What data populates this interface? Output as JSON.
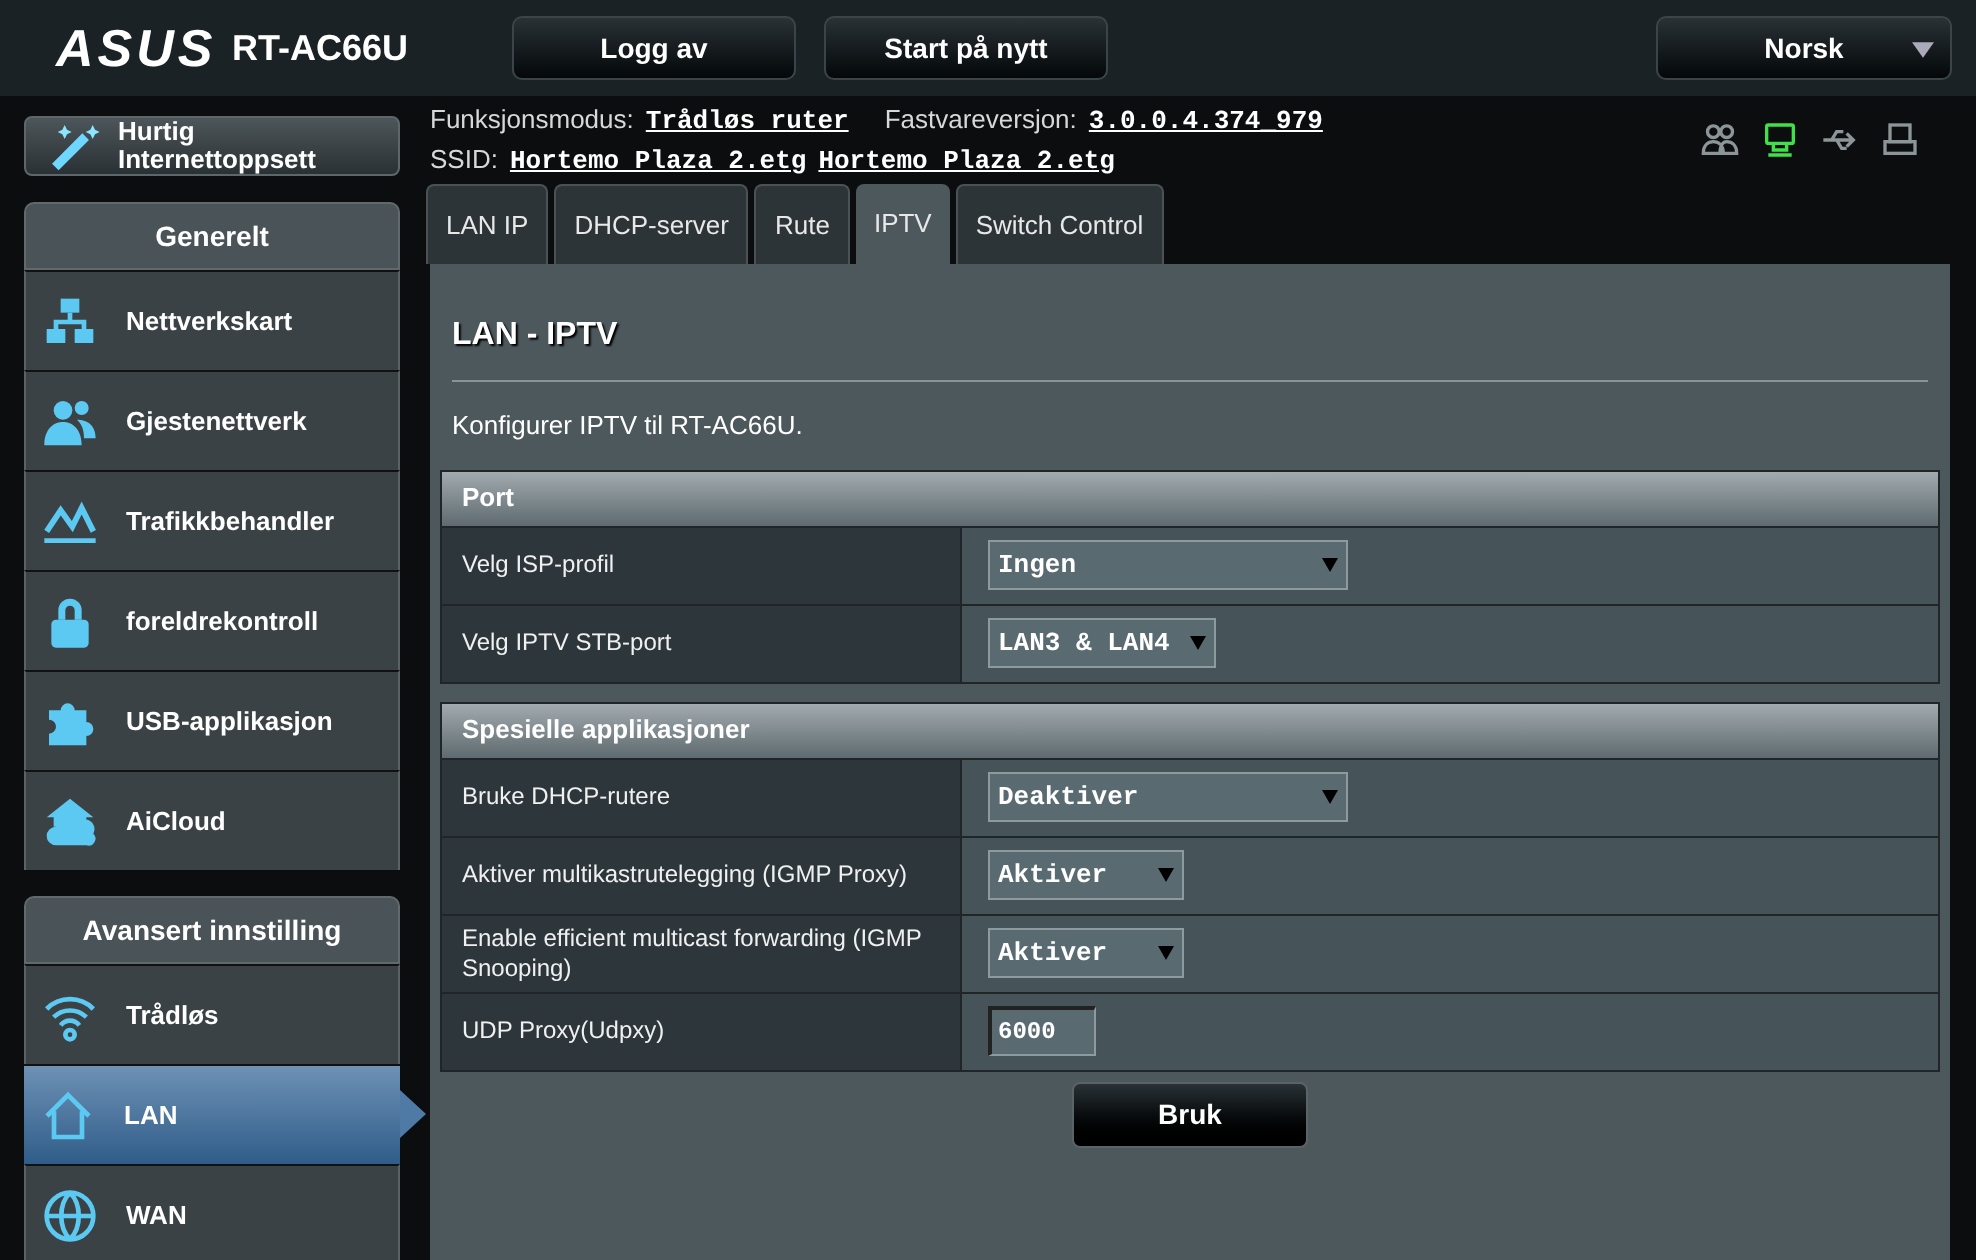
{
  "header": {
    "logo": "ASUS",
    "model": "RT-AC66U",
    "buttons": [
      "Logg av",
      "Start på nytt"
    ],
    "language": "Norsk"
  },
  "info": {
    "mode_label": "Funksjonsmodus:",
    "mode_value": "Trådløs ruter",
    "firmware_label": "Fastvareversjon:",
    "firmware_value": "3.0.0.4.374_979",
    "ssid_label": "SSID:",
    "ssid_values": [
      "Hortemo Plaza 2.etg",
      "Hortemo Plaza 2.etg"
    ]
  },
  "status_icons": [
    {
      "kind": "clients",
      "on": false
    },
    {
      "kind": "network",
      "on": true
    },
    {
      "kind": "usb",
      "on": false
    },
    {
      "kind": "printer",
      "on": false
    }
  ],
  "sidebar": {
    "quick_setup": "Hurtig Internettoppsett",
    "sections": [
      {
        "title": "Generelt",
        "items": [
          {
            "label": "Nettverkskart",
            "kind": "network",
            "selected": false
          },
          {
            "label": "Gjestenettverk",
            "kind": "guests",
            "selected": false
          },
          {
            "label": "Trafikkbehandler",
            "kind": "traffic",
            "selected": false
          },
          {
            "label": "foreldrekontroll",
            "kind": "lock",
            "selected": false
          },
          {
            "label": "USB-applikasjon",
            "kind": "puzzle",
            "selected": false
          },
          {
            "label": "AiCloud",
            "kind": "cloud",
            "selected": false
          }
        ]
      },
      {
        "title": "Avansert innstilling",
        "items": [
          {
            "label": "Trådløs",
            "kind": "wifi",
            "selected": false
          },
          {
            "label": "LAN",
            "kind": "home",
            "selected": true
          },
          {
            "label": "WAN",
            "kind": "globe",
            "selected": false
          }
        ]
      }
    ]
  },
  "tabs": [
    {
      "label": "LAN IP",
      "selected": false
    },
    {
      "label": "DHCP-server",
      "selected": false
    },
    {
      "label": "Rute",
      "selected": false
    },
    {
      "label": "IPTV",
      "selected": true
    },
    {
      "label": "Switch Control",
      "selected": false
    }
  ],
  "page": {
    "title": "LAN - IPTV",
    "description": "Konfigurer IPTV til RT-AC66U.",
    "tables": [
      {
        "title": "Port",
        "rows": [
          {
            "label": "Velg ISP-profil",
            "kind": "select",
            "value": "Ingen"
          },
          {
            "label": "Velg IPTV STB-port",
            "kind": "select",
            "value": "LAN3 & LAN4"
          }
        ]
      },
      {
        "title": "Spesielle applikasjoner",
        "rows": [
          {
            "label": "Bruke DHCP-rutere",
            "kind": "select",
            "value": "Deaktiver"
          },
          {
            "label": "Aktiver multikastrutelegging (IGMP Proxy)",
            "kind": "select",
            "value": "Aktiver"
          },
          {
            "label": "Enable efficient multicast forwarding (IGMP Snooping)",
            "kind": "select",
            "value": "Aktiver"
          },
          {
            "label": "UDP Proxy(Udpxy)",
            "kind": "input",
            "value": "6000"
          }
        ]
      }
    ],
    "apply_button": "Bruk"
  }
}
